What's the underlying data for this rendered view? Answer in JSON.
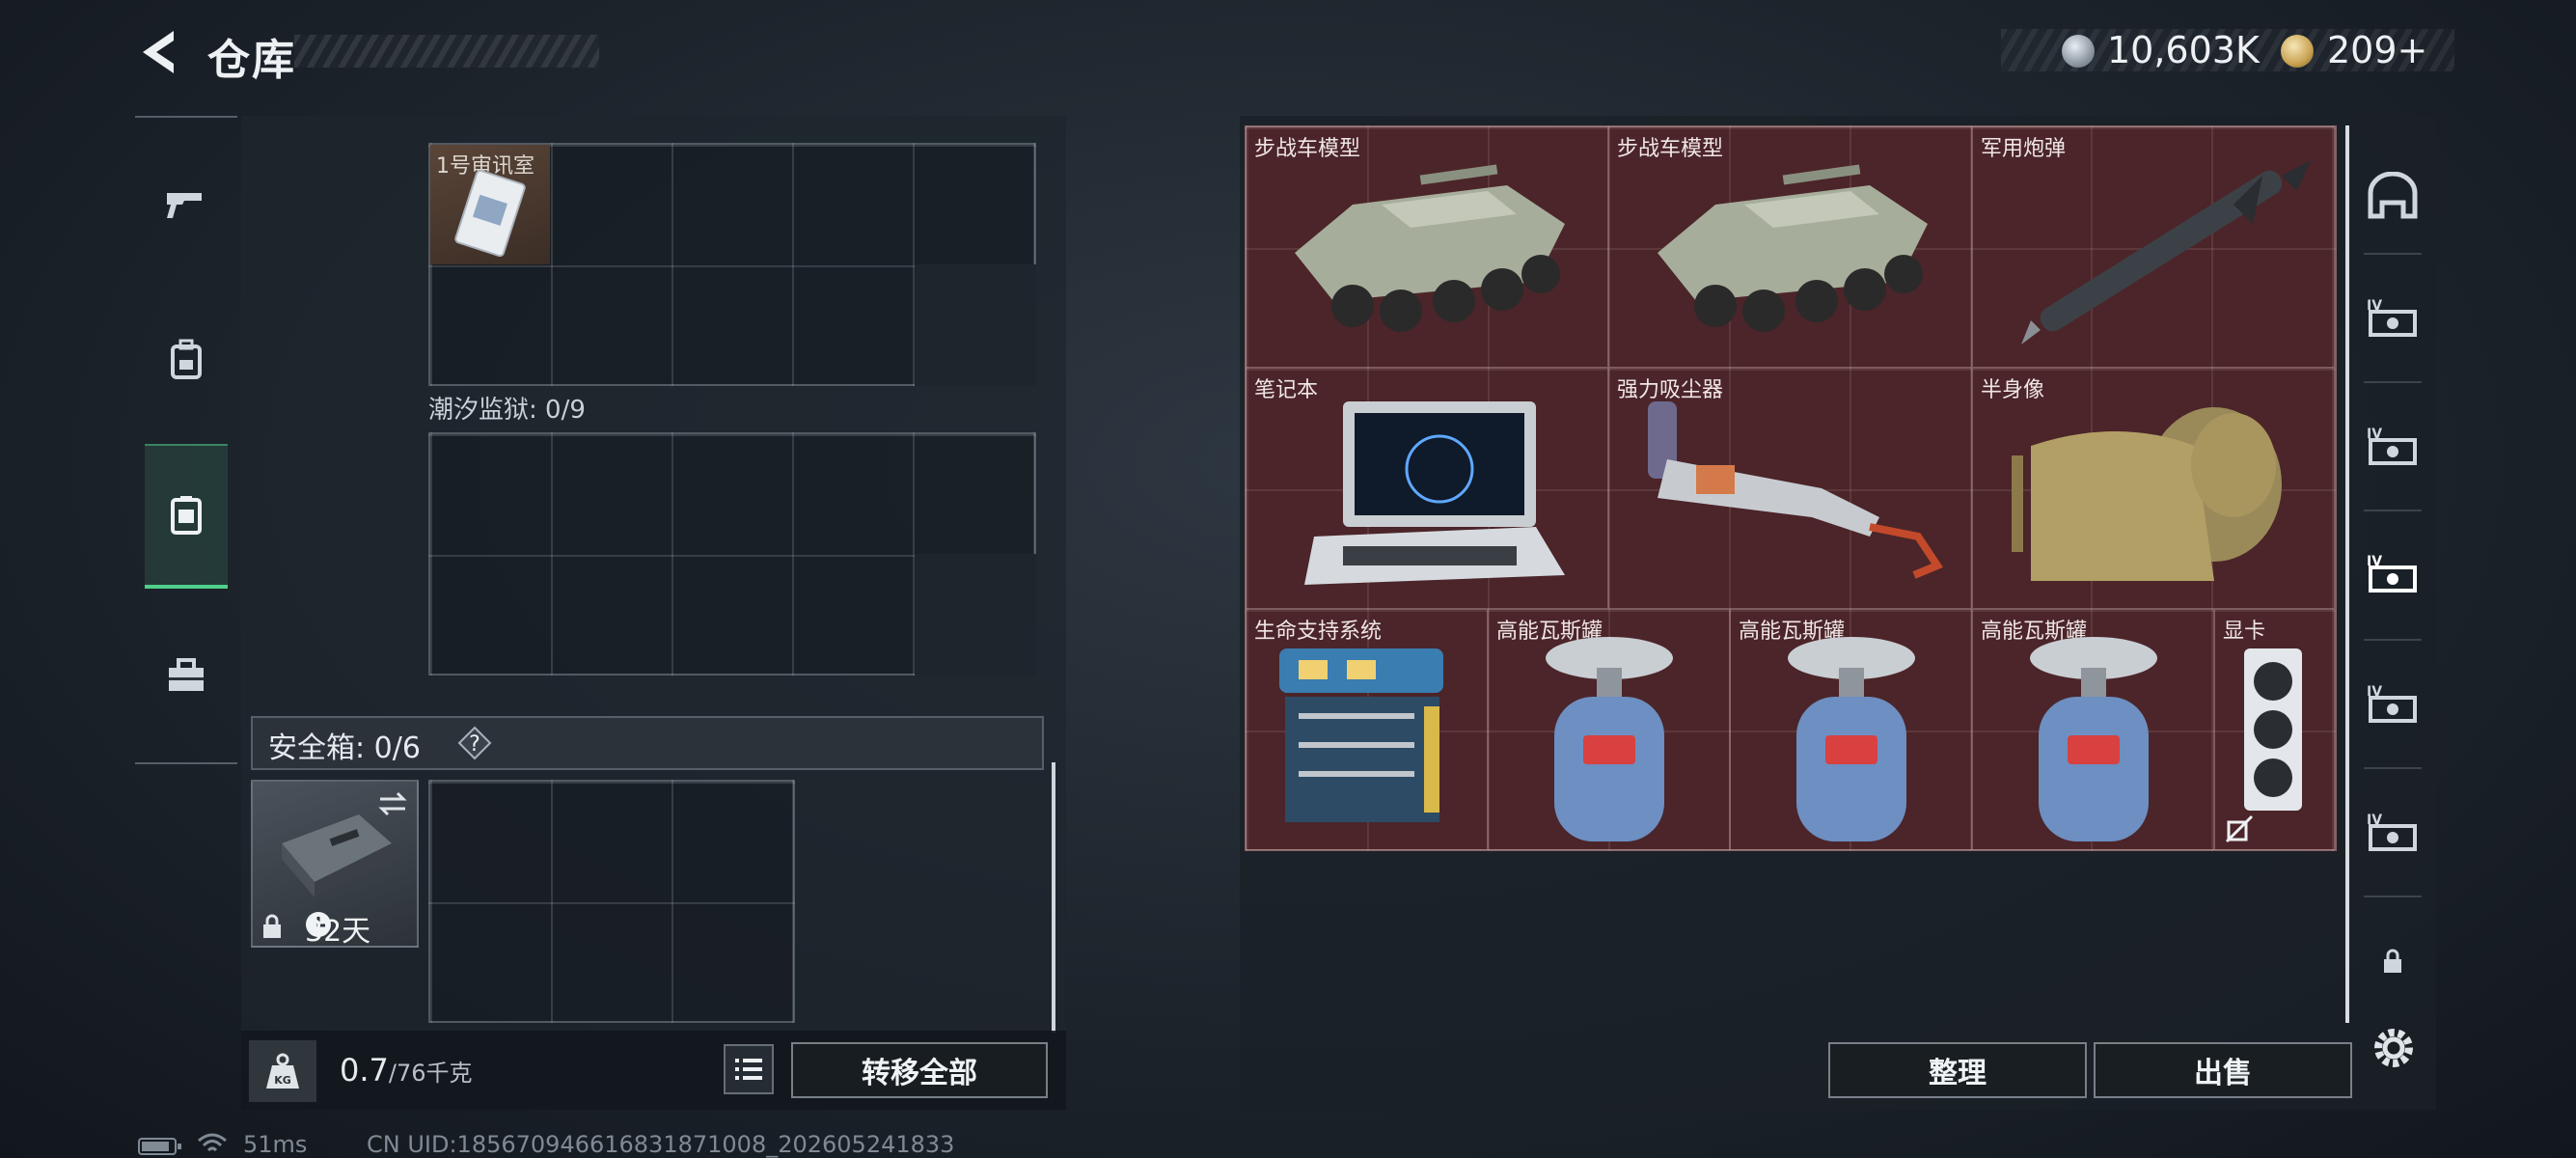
{
  "header": {
    "title": "仓库",
    "currency": [
      {
        "icon": "silver-coin-icon",
        "value": "10,603K"
      },
      {
        "icon": "gold-coin-icon",
        "value": "209"
      }
    ],
    "add_label": "+"
  },
  "left_tabs": [
    {
      "icon": "pistol-icon",
      "active": false
    },
    {
      "icon": "backpack-icon",
      "active": false
    },
    {
      "icon": "chest-rig-icon",
      "active": true
    },
    {
      "icon": "toolbox-icon",
      "active": false
    }
  ],
  "containers": [
    {
      "label": "",
      "items": [
        {
          "name": "1号审讯室",
          "icon": "keycard-icon"
        }
      ]
    },
    {
      "label": "潮汐监狱: 0/9",
      "items": []
    }
  ],
  "safe_box": {
    "label": "安全箱: 0/6",
    "help": "?",
    "duration": "32天"
  },
  "weight": {
    "current": "0.7",
    "max": "/76千克"
  },
  "buttons": {
    "transfer_all": "转移全部",
    "sort": "整理",
    "sell": "出售"
  },
  "stash_items": [
    {
      "name": "步战车模型",
      "icon": "ifv-model-icon"
    },
    {
      "name": "步战车模型",
      "icon": "ifv-model-icon"
    },
    {
      "name": "军用炮弹",
      "icon": "missile-icon"
    },
    {
      "name": "笔记本",
      "icon": "laptop-icon"
    },
    {
      "name": "强力吸尘器",
      "icon": "vacuum-icon"
    },
    {
      "name": "半身像",
      "icon": "bust-icon"
    },
    {
      "name": "生命支持系统",
      "icon": "life-support-icon"
    },
    {
      "name": "高能瓦斯罐",
      "icon": "gas-tank-icon"
    },
    {
      "name": "高能瓦斯罐",
      "icon": "gas-tank-icon"
    },
    {
      "name": "高能瓦斯罐",
      "icon": "gas-tank-icon"
    },
    {
      "name": "显卡",
      "icon": "gpu-icon"
    }
  ],
  "right_tabs": [
    {
      "icon": "helmet-icon"
    },
    {
      "icon": "case-iv-icon"
    },
    {
      "icon": "case-iv-icon"
    },
    {
      "icon": "case-iv-icon"
    },
    {
      "icon": "case-iv-icon"
    },
    {
      "icon": "case-iv-icon"
    }
  ],
  "status": {
    "ping": "51ms",
    "uid": "CN UID:185670946616831871008_202605241833"
  },
  "colors": {
    "accent": "#4fd08a",
    "stash_bg": "#4b2529"
  }
}
